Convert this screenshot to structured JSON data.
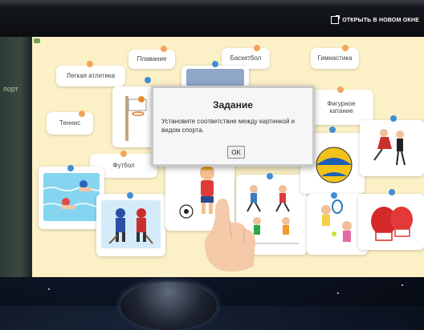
{
  "topbar": {
    "open_new_window": "ОТКРЫТЬ В НОВОМ ОКНЕ"
  },
  "side": {
    "left_text": "порт"
  },
  "labels": {
    "swimming": "Плавание",
    "basketball": "Баскетбол",
    "gymnastics": "Гимнастика",
    "athletics": "Легкая атлетика",
    "figure_skating": "Фигурное катание",
    "tennis": "Теннис",
    "football": "Футбол"
  },
  "dialog": {
    "title": "Задание",
    "text": "Установите соответствие между картинкой и видом спорта.",
    "ok": "OK"
  },
  "pictures": [
    "swimmers-picture",
    "hockey-players-picture",
    "basketball-hoop-picture",
    "football-kid-picture",
    "athletes-picture",
    "volleyball-picture",
    "tennis-kids-picture",
    "figure-skaters-picture",
    "boxing-gloves-picture"
  ],
  "colors": {
    "board": "#fbf0c6",
    "pin_orange": "#f3a45b",
    "pin_blue": "#3f8fd6"
  }
}
